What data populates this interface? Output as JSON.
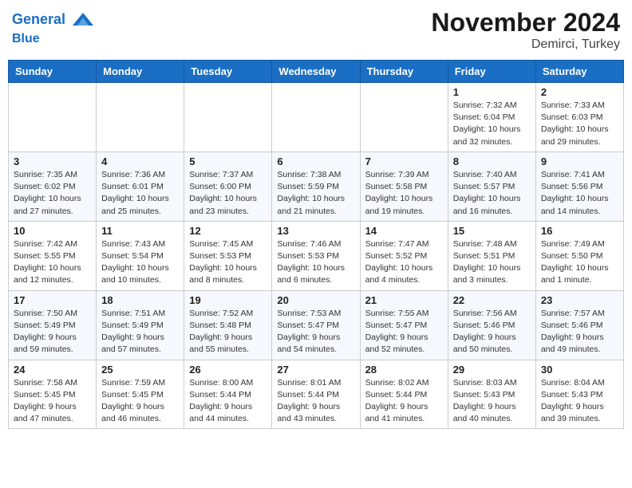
{
  "header": {
    "logo_line1": "General",
    "logo_line2": "Blue",
    "month": "November 2024",
    "location": "Demirci, Turkey"
  },
  "weekdays": [
    "Sunday",
    "Monday",
    "Tuesday",
    "Wednesday",
    "Thursday",
    "Friday",
    "Saturday"
  ],
  "weeks": [
    [
      {
        "day": "",
        "info": ""
      },
      {
        "day": "",
        "info": ""
      },
      {
        "day": "",
        "info": ""
      },
      {
        "day": "",
        "info": ""
      },
      {
        "day": "",
        "info": ""
      },
      {
        "day": "1",
        "info": "Sunrise: 7:32 AM\nSunset: 6:04 PM\nDaylight: 10 hours and 32 minutes."
      },
      {
        "day": "2",
        "info": "Sunrise: 7:33 AM\nSunset: 6:03 PM\nDaylight: 10 hours and 29 minutes."
      }
    ],
    [
      {
        "day": "3",
        "info": "Sunrise: 7:35 AM\nSunset: 6:02 PM\nDaylight: 10 hours and 27 minutes."
      },
      {
        "day": "4",
        "info": "Sunrise: 7:36 AM\nSunset: 6:01 PM\nDaylight: 10 hours and 25 minutes."
      },
      {
        "day": "5",
        "info": "Sunrise: 7:37 AM\nSunset: 6:00 PM\nDaylight: 10 hours and 23 minutes."
      },
      {
        "day": "6",
        "info": "Sunrise: 7:38 AM\nSunset: 5:59 PM\nDaylight: 10 hours and 21 minutes."
      },
      {
        "day": "7",
        "info": "Sunrise: 7:39 AM\nSunset: 5:58 PM\nDaylight: 10 hours and 19 minutes."
      },
      {
        "day": "8",
        "info": "Sunrise: 7:40 AM\nSunset: 5:57 PM\nDaylight: 10 hours and 16 minutes."
      },
      {
        "day": "9",
        "info": "Sunrise: 7:41 AM\nSunset: 5:56 PM\nDaylight: 10 hours and 14 minutes."
      }
    ],
    [
      {
        "day": "10",
        "info": "Sunrise: 7:42 AM\nSunset: 5:55 PM\nDaylight: 10 hours and 12 minutes."
      },
      {
        "day": "11",
        "info": "Sunrise: 7:43 AM\nSunset: 5:54 PM\nDaylight: 10 hours and 10 minutes."
      },
      {
        "day": "12",
        "info": "Sunrise: 7:45 AM\nSunset: 5:53 PM\nDaylight: 10 hours and 8 minutes."
      },
      {
        "day": "13",
        "info": "Sunrise: 7:46 AM\nSunset: 5:53 PM\nDaylight: 10 hours and 6 minutes."
      },
      {
        "day": "14",
        "info": "Sunrise: 7:47 AM\nSunset: 5:52 PM\nDaylight: 10 hours and 4 minutes."
      },
      {
        "day": "15",
        "info": "Sunrise: 7:48 AM\nSunset: 5:51 PM\nDaylight: 10 hours and 3 minutes."
      },
      {
        "day": "16",
        "info": "Sunrise: 7:49 AM\nSunset: 5:50 PM\nDaylight: 10 hours and 1 minute."
      }
    ],
    [
      {
        "day": "17",
        "info": "Sunrise: 7:50 AM\nSunset: 5:49 PM\nDaylight: 9 hours and 59 minutes."
      },
      {
        "day": "18",
        "info": "Sunrise: 7:51 AM\nSunset: 5:49 PM\nDaylight: 9 hours and 57 minutes."
      },
      {
        "day": "19",
        "info": "Sunrise: 7:52 AM\nSunset: 5:48 PM\nDaylight: 9 hours and 55 minutes."
      },
      {
        "day": "20",
        "info": "Sunrise: 7:53 AM\nSunset: 5:47 PM\nDaylight: 9 hours and 54 minutes."
      },
      {
        "day": "21",
        "info": "Sunrise: 7:55 AM\nSunset: 5:47 PM\nDaylight: 9 hours and 52 minutes."
      },
      {
        "day": "22",
        "info": "Sunrise: 7:56 AM\nSunset: 5:46 PM\nDaylight: 9 hours and 50 minutes."
      },
      {
        "day": "23",
        "info": "Sunrise: 7:57 AM\nSunset: 5:46 PM\nDaylight: 9 hours and 49 minutes."
      }
    ],
    [
      {
        "day": "24",
        "info": "Sunrise: 7:58 AM\nSunset: 5:45 PM\nDaylight: 9 hours and 47 minutes."
      },
      {
        "day": "25",
        "info": "Sunrise: 7:59 AM\nSunset: 5:45 PM\nDaylight: 9 hours and 46 minutes."
      },
      {
        "day": "26",
        "info": "Sunrise: 8:00 AM\nSunset: 5:44 PM\nDaylight: 9 hours and 44 minutes."
      },
      {
        "day": "27",
        "info": "Sunrise: 8:01 AM\nSunset: 5:44 PM\nDaylight: 9 hours and 43 minutes."
      },
      {
        "day": "28",
        "info": "Sunrise: 8:02 AM\nSunset: 5:44 PM\nDaylight: 9 hours and 41 minutes."
      },
      {
        "day": "29",
        "info": "Sunrise: 8:03 AM\nSunset: 5:43 PM\nDaylight: 9 hours and 40 minutes."
      },
      {
        "day": "30",
        "info": "Sunrise: 8:04 AM\nSunset: 5:43 PM\nDaylight: 9 hours and 39 minutes."
      }
    ]
  ]
}
